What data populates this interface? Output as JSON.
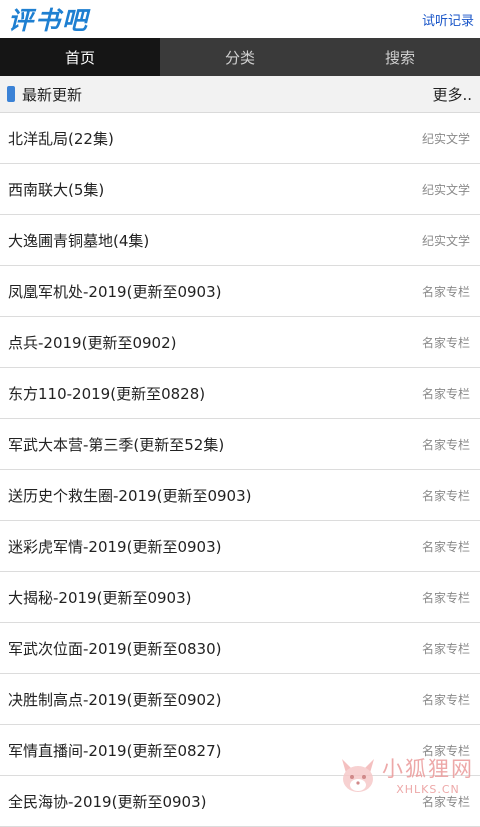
{
  "header": {
    "logo": "评书吧",
    "history_link": "试听记录"
  },
  "nav": {
    "tabs": [
      {
        "label": "首页",
        "active": true
      },
      {
        "label": "分类",
        "active": false
      },
      {
        "label": "搜索",
        "active": false
      }
    ]
  },
  "section": {
    "title": "最新更新",
    "more": "更多.."
  },
  "list": [
    {
      "title": "北洋乱局(22集)",
      "category": "纪实文学"
    },
    {
      "title": "西南联大(5集)",
      "category": "纪实文学"
    },
    {
      "title": "大逸圃青铜墓地(4集)",
      "category": "纪实文学"
    },
    {
      "title": "凤凰军机处-2019(更新至0903)",
      "category": "名家专栏"
    },
    {
      "title": "点兵-2019(更新至0902)",
      "category": "名家专栏"
    },
    {
      "title": "东方110-2019(更新至0828)",
      "category": "名家专栏"
    },
    {
      "title": "军武大本营-第三季(更新至52集)",
      "category": "名家专栏"
    },
    {
      "title": "送历史个救生圈-2019(更新至0903)",
      "category": "名家专栏"
    },
    {
      "title": "迷彩虎军情-2019(更新至0903)",
      "category": "名家专栏"
    },
    {
      "title": "大揭秘-2019(更新至0903)",
      "category": "名家专栏"
    },
    {
      "title": "军武次位面-2019(更新至0830)",
      "category": "名家专栏"
    },
    {
      "title": "决胜制高点-2019(更新至0902)",
      "category": "名家专栏"
    },
    {
      "title": "军情直播间-2019(更新至0827)",
      "category": "名家专栏"
    },
    {
      "title": "全民海协-2019(更新至0903)",
      "category": "名家专栏"
    }
  ],
  "watermark": {
    "name": "小狐狸网",
    "domain": "XHLKS.CN"
  },
  "colors": {
    "logo": "#1e7fd1",
    "nav_bg": "#3a3a3a",
    "nav_active_bg": "#151515",
    "section_marker": "#3b82d6",
    "link": "#1a56c8"
  }
}
